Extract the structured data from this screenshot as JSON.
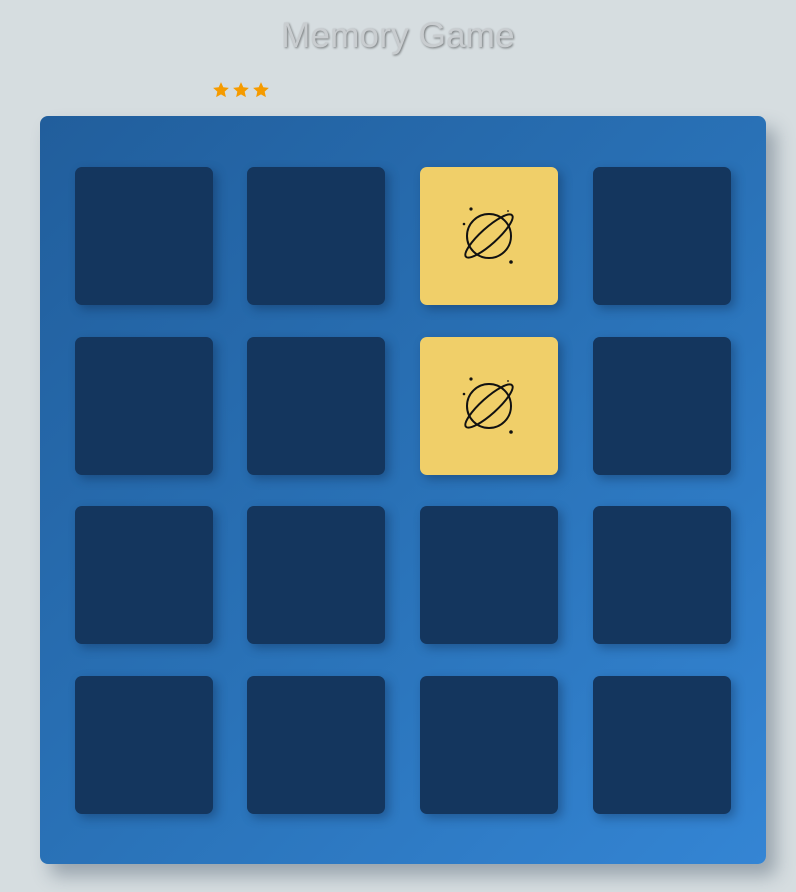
{
  "header": {
    "title": "Memory Game"
  },
  "rating": {
    "stars": 3,
    "star_color": "#f59b00"
  },
  "board": {
    "rows": 4,
    "cols": 4,
    "colors": {
      "board": "#2a73b9",
      "card_back": "#14365e",
      "card_open": "#f0cf69"
    },
    "cards": [
      {
        "state": "hidden",
        "symbol": null
      },
      {
        "state": "hidden",
        "symbol": null
      },
      {
        "state": "open",
        "symbol": "planet-icon"
      },
      {
        "state": "hidden",
        "symbol": null
      },
      {
        "state": "hidden",
        "symbol": null
      },
      {
        "state": "hidden",
        "symbol": null
      },
      {
        "state": "open",
        "symbol": "planet-icon"
      },
      {
        "state": "hidden",
        "symbol": null
      },
      {
        "state": "hidden",
        "symbol": null
      },
      {
        "state": "hidden",
        "symbol": null
      },
      {
        "state": "hidden",
        "symbol": null
      },
      {
        "state": "hidden",
        "symbol": null
      },
      {
        "state": "hidden",
        "symbol": null
      },
      {
        "state": "hidden",
        "symbol": null
      },
      {
        "state": "hidden",
        "symbol": null
      },
      {
        "state": "hidden",
        "symbol": null
      }
    ]
  }
}
